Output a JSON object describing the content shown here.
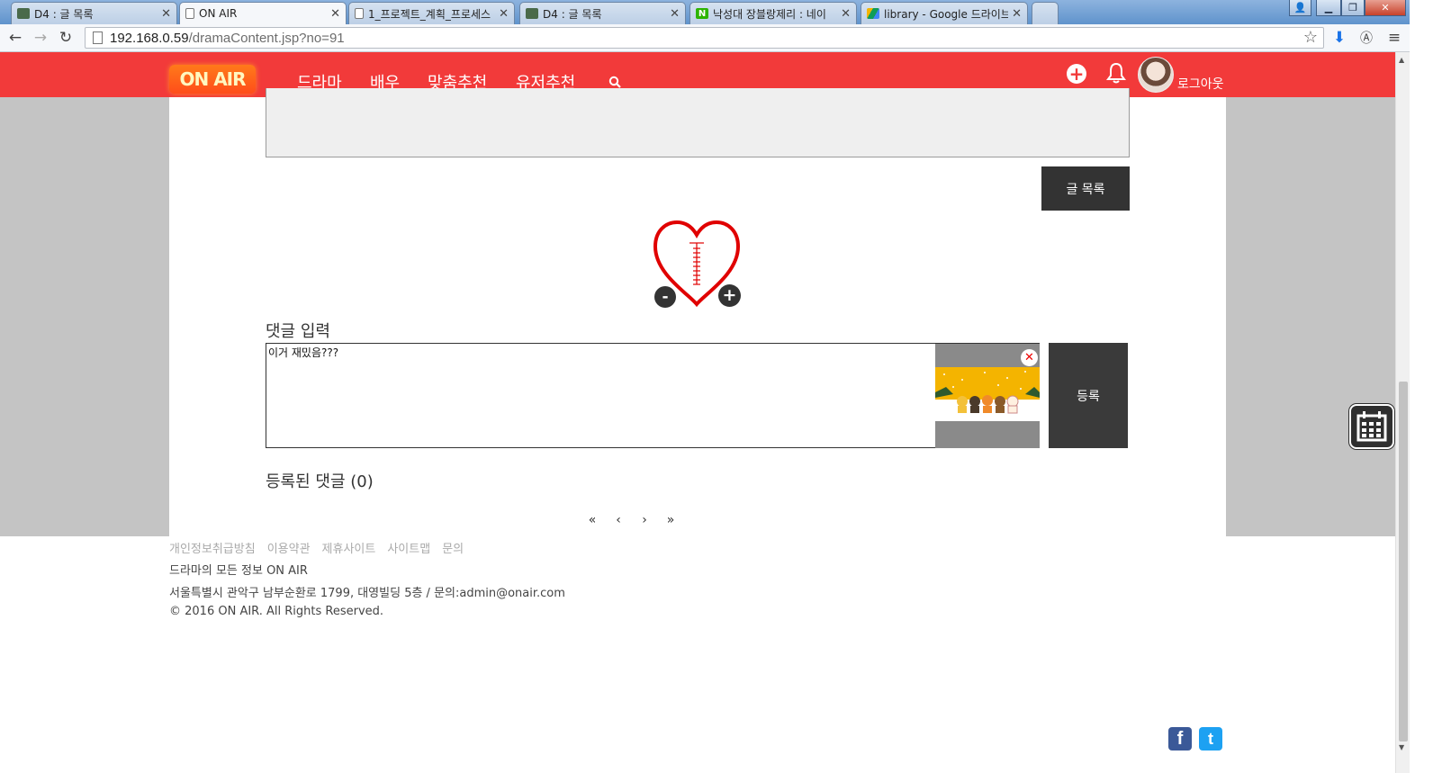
{
  "browser": {
    "tabs": [
      {
        "title": "D4 : 글 목록",
        "icon": "db-icon",
        "active": false
      },
      {
        "title": "ON AIR",
        "icon": "page-icon",
        "active": true
      },
      {
        "title": "1_프로젝트_계획_프로세스",
        "icon": "page-icon",
        "active": false
      },
      {
        "title": "D4 : 글 목록",
        "icon": "db-icon",
        "active": false
      },
      {
        "title": "낙성대 장블랑제리 : 네이",
        "icon": "naver-icon",
        "active": false
      },
      {
        "title": "library - Google 드라이브",
        "icon": "drive-icon",
        "active": false
      }
    ],
    "url_host": "192.168.0.59",
    "url_path": "/dramaContent.jsp?no=91"
  },
  "header": {
    "logo": "ON AIR",
    "menu": [
      "드라마",
      "배우",
      "맞춤추천",
      "유저추천"
    ],
    "logout": "로그아웃",
    "colors": {
      "brand": "#f23a3a",
      "logo_bg": "#ff5a1a"
    }
  },
  "article": {
    "list_button": "글 목록"
  },
  "comments": {
    "heading": "댓글 입력",
    "input_value": "이거 재밌음???",
    "submit": "등록",
    "count_label": "등록된 댓글 (0)"
  },
  "pagination": [
    "«",
    "‹",
    "›",
    "»"
  ],
  "footer": {
    "links": [
      "개인정보취급방침",
      "이용약관",
      "제휴사이트",
      "사이트맵",
      "문의"
    ],
    "tagline": "드라마의 모든 정보 ON AIR",
    "address": "서울특별시 관악구 남부순환로 1799, 대영빌딩 5층 / 문의:admin@onair.com",
    "copyright": "© 2016 ON AIR. All Rights Reserved."
  },
  "social": {
    "facebook": "f",
    "twitter": "t"
  }
}
